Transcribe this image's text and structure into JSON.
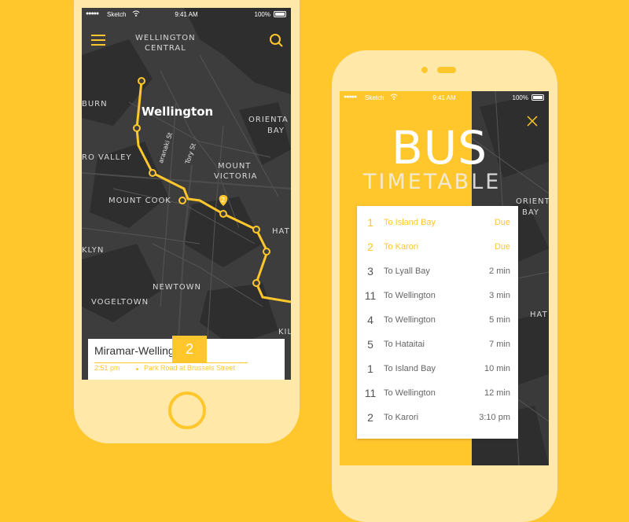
{
  "colors": {
    "accent": "#FFC72C",
    "background": "#FFC72C",
    "map": "#3a3a3a"
  },
  "status_bar": {
    "carrier": "Sketch",
    "time": "9:41 AM",
    "battery": "100%",
    "signal": "●●●●●",
    "wifi_icon": "wifi-icon"
  },
  "map": {
    "labels": {
      "wellington_central_1": "WELLINGTON",
      "wellington_central_2": "CENTRAL",
      "city": "Wellington",
      "burn": "BURN",
      "oriental_bay_1": "ORIENTA",
      "oriental_bay_2": "BAY",
      "ro_valley": "RO VALLEY",
      "mount_victoria_1": "MOUNT",
      "mount_victoria_2": "VICTORIA",
      "mount_cook": "MOUNT COOK",
      "hat": "HAT",
      "klyn": "KLYN",
      "newtown": "NEWTOWN",
      "vogeltown": "VOGELTOWN",
      "kil": "KIL",
      "taranaki": "aranaki St",
      "tory": "Tory St"
    },
    "marker": "2"
  },
  "route_card": {
    "name": "Miramar-Wellington",
    "time": "2:51 pm",
    "stop": "Park Road at Brussels Street",
    "route_number": "2"
  },
  "timetable": {
    "title": "BUS",
    "subtitle": "TIMETABLE",
    "bg_labels": {
      "orienta": "ORIENTA",
      "bay": "BAY",
      "hat": "HAT"
    },
    "rows": [
      {
        "num": "1",
        "dest": "To Island Bay",
        "eta": "Due",
        "due": true
      },
      {
        "num": "2",
        "dest": "To Karori",
        "eta": "Due",
        "due": true
      },
      {
        "num": "3",
        "dest": "To Lyall Bay",
        "eta": "2 min",
        "due": false
      },
      {
        "num": "11",
        "dest": "To Wellington",
        "eta": "3 min",
        "due": false
      },
      {
        "num": "4",
        "dest": "To Wellington",
        "eta": "5 min",
        "due": false
      },
      {
        "num": "5",
        "dest": "To Hataitai",
        "eta": "7 min",
        "due": false
      },
      {
        "num": "1",
        "dest": "To Island Bay",
        "eta": "10 min",
        "due": false
      },
      {
        "num": "11",
        "dest": "To Wellington",
        "eta": "12 min",
        "due": false
      },
      {
        "num": "2",
        "dest": "To Karori",
        "eta": "3:10 pm",
        "due": false
      }
    ]
  }
}
